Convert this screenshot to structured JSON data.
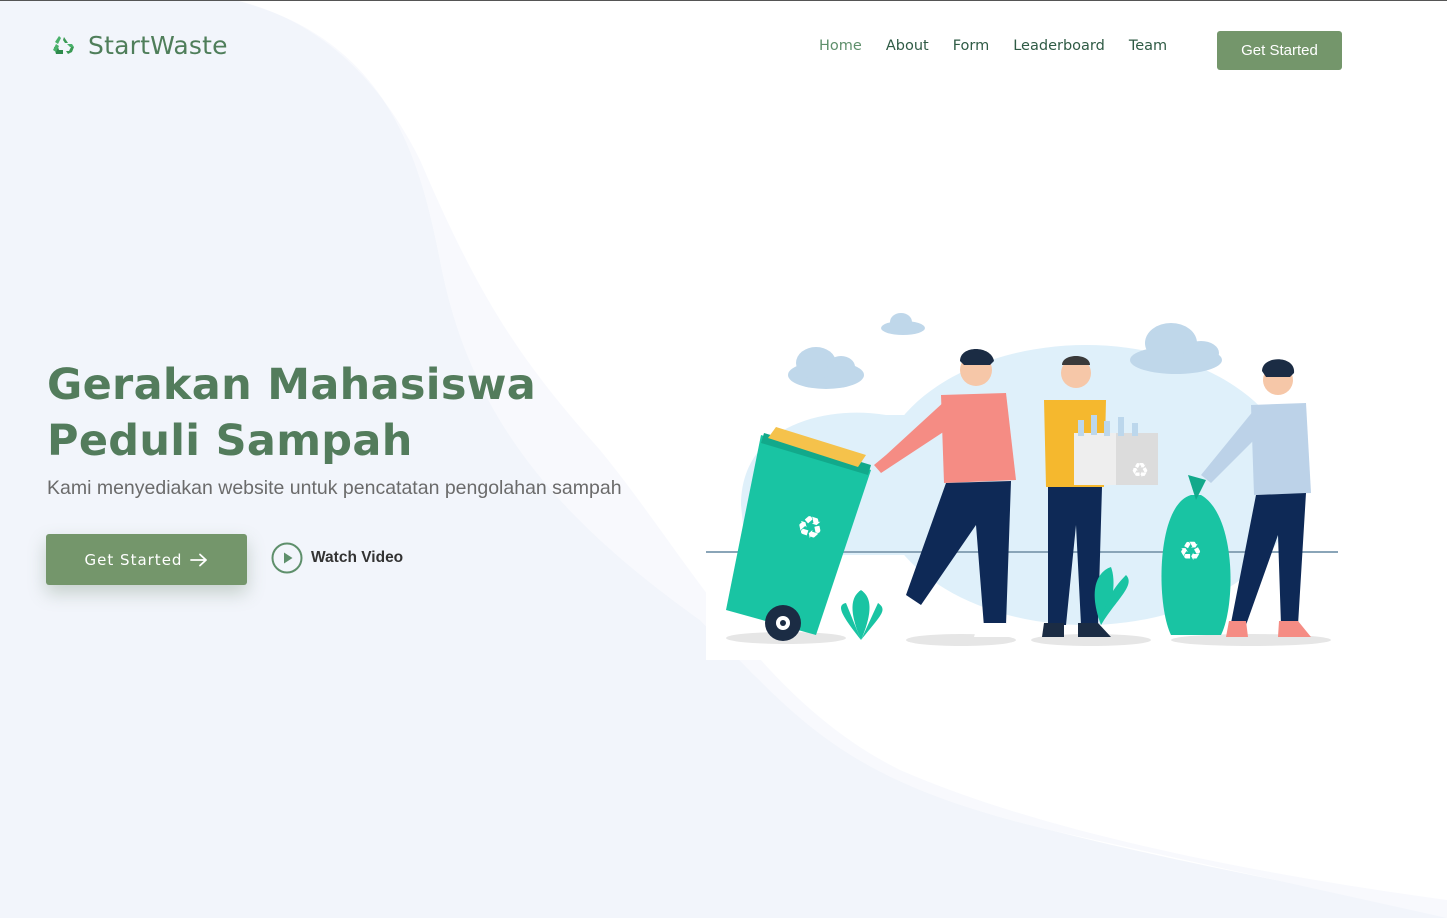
{
  "brand": {
    "name": "StartWaste",
    "icon": "recycle-icon",
    "accent_color": "#74966b",
    "title_color": "#537c5c"
  },
  "nav": {
    "items": [
      {
        "label": "Home",
        "active": true
      },
      {
        "label": "About",
        "active": false
      },
      {
        "label": "Form",
        "active": false
      },
      {
        "label": "Leaderboard",
        "active": false
      },
      {
        "label": "Team",
        "active": false
      }
    ],
    "cta_label": "Get Started"
  },
  "hero": {
    "title": "Gerakan Mahasiswa Peduli Sampah",
    "subtitle": "Kami menyediakan website untuk pencatatan pengolahan sampah",
    "primary_button": {
      "label": "Get Started",
      "icon": "arrow-right-icon"
    },
    "secondary_button": {
      "label": "Watch Video",
      "icon": "play-circle-icon"
    }
  }
}
